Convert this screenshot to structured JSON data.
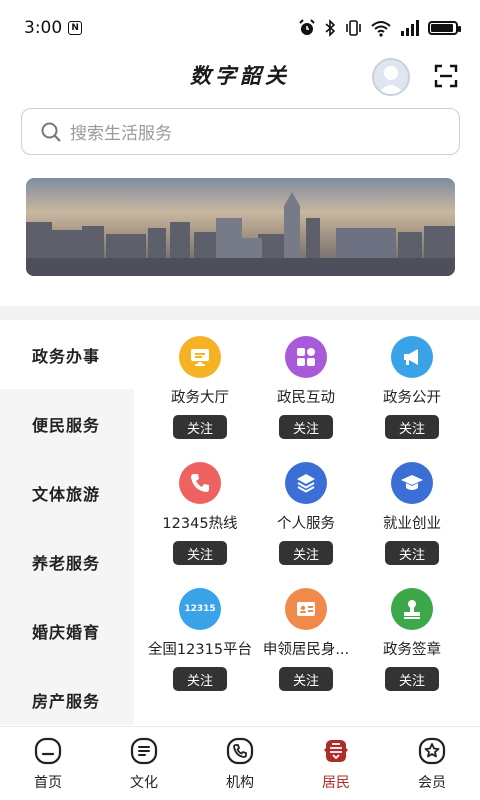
{
  "status": {
    "time": "3:00",
    "nfc": "N"
  },
  "header": {
    "title": "数字韶关"
  },
  "search": {
    "placeholder": "搜索生活服务"
  },
  "categories": [
    {
      "label": "政务办事",
      "active": true
    },
    {
      "label": "便民服务",
      "active": false
    },
    {
      "label": "文体旅游",
      "active": false
    },
    {
      "label": "养老服务",
      "active": false
    },
    {
      "label": "婚庆婚育",
      "active": false
    },
    {
      "label": "房产服务",
      "active": false
    }
  ],
  "services": [
    {
      "label": "政务大厅",
      "icon": "monitor-icon",
      "color": "#f5b324",
      "follow": "关注"
    },
    {
      "label": "政民互动",
      "icon": "grid-icon",
      "color": "#a85ad9",
      "follow": "关注"
    },
    {
      "label": "政务公开",
      "icon": "megaphone-icon",
      "color": "#3aa3e8",
      "follow": "关注"
    },
    {
      "label": "12345热线",
      "icon": "phone-icon",
      "color": "#ef6262",
      "follow": "关注"
    },
    {
      "label": "个人服务",
      "icon": "layers-icon",
      "color": "#3b6fd6",
      "follow": "关注"
    },
    {
      "label": "就业创业",
      "icon": "graduation-cap-icon",
      "color": "#3b6fd6",
      "follow": "关注"
    },
    {
      "label": "全国12315平台",
      "icon": "badge-12315-icon",
      "badge_text": "12315",
      "color": "#3aa3e8",
      "follow": "关注"
    },
    {
      "label": "申领居民身...",
      "icon": "id-card-icon",
      "color": "#f08a4b",
      "follow": "关注"
    },
    {
      "label": "政务签章",
      "icon": "stamp-icon",
      "color": "#3da84a",
      "follow": "关注"
    }
  ],
  "tabs": [
    {
      "label": "首页",
      "icon": "home-icon",
      "active": false
    },
    {
      "label": "文化",
      "icon": "document-icon",
      "active": false
    },
    {
      "label": "机构",
      "icon": "phone-circle-icon",
      "active": false
    },
    {
      "label": "居民",
      "icon": "resident-icon",
      "active": true
    },
    {
      "label": "会员",
      "icon": "member-star-icon",
      "active": false
    }
  ],
  "colors": {
    "accent": "#b02a2a",
    "follow_bg": "#333333"
  }
}
